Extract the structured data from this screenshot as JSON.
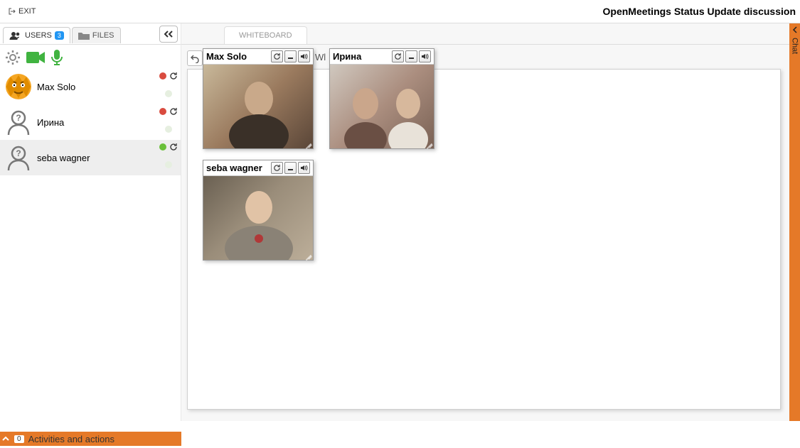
{
  "header": {
    "exit_label": "EXIT",
    "room_title": "OpenMeetings Status Update discussion"
  },
  "sidebar": {
    "tabs": {
      "users": {
        "label": "USERS",
        "count": "3"
      },
      "files": {
        "label": "FILES"
      }
    },
    "users": [
      {
        "name": "Max Solo",
        "status": "red"
      },
      {
        "name": "Ирина",
        "status": "red"
      },
      {
        "name": "seba wagner",
        "status": "green"
      }
    ]
  },
  "whiteboard": {
    "tab_label": "WHITEBOARD",
    "fragment_label": "Wl"
  },
  "videos": [
    {
      "name": "Max Solo"
    },
    {
      "name": "Ирина"
    },
    {
      "name": "seba wagner"
    }
  ],
  "chat": {
    "label": "Chat"
  },
  "bottom": {
    "count": "0",
    "label": "Activities and actions"
  },
  "icons": {
    "gear": "gear",
    "camera": "camera",
    "mic": "mic"
  }
}
